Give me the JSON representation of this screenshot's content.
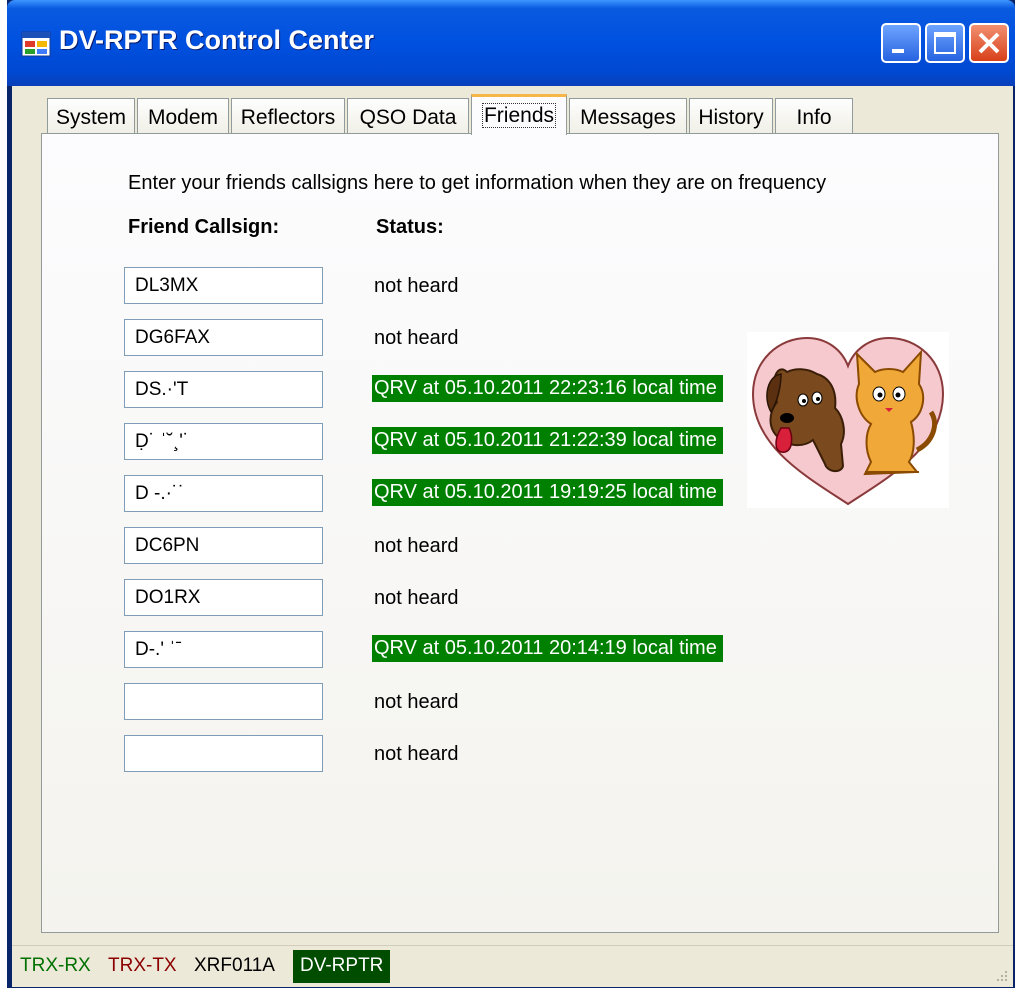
{
  "window": {
    "title": "DV-RPTR Control Center"
  },
  "tabs": [
    {
      "label": "System"
    },
    {
      "label": "Modem"
    },
    {
      "label": "Reflectors"
    },
    {
      "label": "QSO Data"
    },
    {
      "label": "Friends"
    },
    {
      "label": "Messages"
    },
    {
      "label": "History"
    },
    {
      "label": "Info"
    }
  ],
  "active_tab": "Friends",
  "friends": {
    "instruction": "Enter your friends callsigns here to get information when they are on frequency",
    "callsign_header": "Friend Callsign:",
    "status_header": "Status:",
    "rows": [
      {
        "callsign": "DL3MX",
        "status": "not heard"
      },
      {
        "callsign": "DG6FAX",
        "status": "not heard"
      },
      {
        "callsign": "DS.·'T",
        "status": "QRV at 05.10.2011 22:23:16 local time"
      },
      {
        "callsign": "Ḍ˙ ˈ˘¸'˙",
        "status": "QRV at 05.10.2011 21:22:39 local time"
      },
      {
        "callsign": "D ‐.·˙˙",
        "status": "QRV at 05.10.2011 19:19:25 local time"
      },
      {
        "callsign": "DC6PN",
        "status": "not heard"
      },
      {
        "callsign": "DO1RX",
        "status": "not heard"
      },
      {
        "callsign": "D‐.' ˈˉ",
        "status": "QRV at 05.10.2011 20:14:19 local time"
      },
      {
        "callsign": "",
        "status": "not heard"
      },
      {
        "callsign": "",
        "status": "not heard"
      }
    ]
  },
  "statusbar": {
    "rx": "TRX-RX",
    "tx": "TRX-TX",
    "reflector": "XRF011A",
    "device": "DV-RPTR"
  },
  "colors": {
    "qrv_bg": "#008000",
    "rx_text": "#007000",
    "tx_text": "#8b0000",
    "device_bg": "#004d00"
  },
  "icons": [
    "app-icon",
    "minimize-icon",
    "maximize-icon",
    "close-icon",
    "friends-heart-image",
    "resize-grip-icon"
  ]
}
